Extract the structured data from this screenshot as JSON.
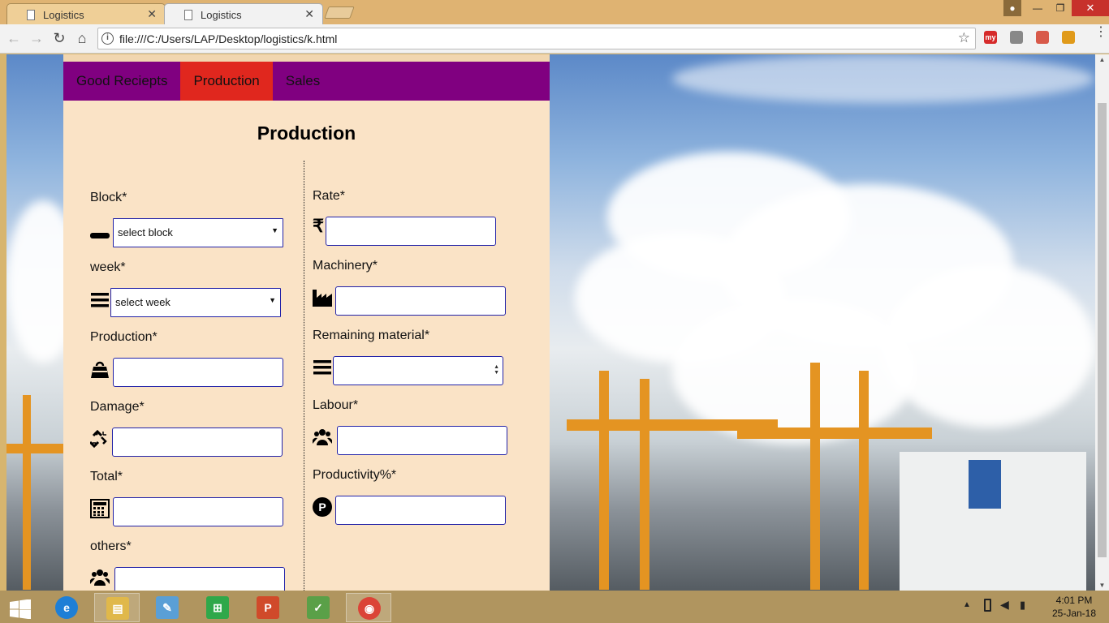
{
  "browser": {
    "tabs": [
      {
        "label": "Logistics",
        "active": false
      },
      {
        "label": "Logistics",
        "active": true
      }
    ],
    "url": "file:///C:/Users/LAP/Desktop/logistics/k.html",
    "extensions": [
      {
        "name": "my-extension",
        "label": "my",
        "color": "#d62b2b"
      },
      {
        "name": "sync-extension",
        "label": "",
        "color": "#888888"
      },
      {
        "name": "dictionary-extension",
        "label": "",
        "color": "#d85a4a"
      },
      {
        "name": "location-extension",
        "label": "",
        "color": "#e09a1a"
      }
    ]
  },
  "nav": {
    "tabs": [
      {
        "label": "Good Reciepts",
        "active": false
      },
      {
        "label": "Production",
        "active": true
      },
      {
        "label": "Sales",
        "active": false
      }
    ]
  },
  "form": {
    "title": "Production",
    "left": {
      "block": {
        "label": "Block*",
        "selected": "select block",
        "icon": "minus-icon"
      },
      "week": {
        "label": "week*",
        "selected": "select week",
        "icon": "bars-icon"
      },
      "production": {
        "label": "Production*",
        "value": "",
        "icon": "weight-icon"
      },
      "damage": {
        "label": "Damage*",
        "value": "",
        "icon": "broken-link-icon"
      },
      "total": {
        "label": "Total*",
        "value": "",
        "icon": "calculator-icon"
      },
      "others": {
        "label": "others*",
        "value": "",
        "icon": "users-icon"
      }
    },
    "right": {
      "rate": {
        "label": "Rate*",
        "value": "",
        "icon": "rupee-icon"
      },
      "machinery": {
        "label": "Machinery*",
        "value": "",
        "icon": "industry-icon"
      },
      "remaining_material": {
        "label": "Remaining material*",
        "value": "",
        "icon": "bars-icon"
      },
      "labour": {
        "label": "Labour*",
        "value": "",
        "icon": "users-icon"
      },
      "productivity": {
        "label": "Productivity%*",
        "value": "",
        "icon": "parking-icon"
      }
    }
  },
  "colors": {
    "panel_bg": "#fae3c6",
    "nav_bg": "#800080",
    "nav_active": "#e0271e",
    "input_border": "#2222a8"
  },
  "taskbar": {
    "apps": [
      {
        "name": "internet-explorer-icon",
        "color": "#1e7fd6"
      },
      {
        "name": "file-explorer-icon",
        "color": "#e0b84a"
      },
      {
        "name": "paint-icon",
        "color": "#5a9fd6"
      },
      {
        "name": "store-icon",
        "color": "#2fa84a"
      },
      {
        "name": "powerpoint-icon",
        "color": "#d04a2a"
      },
      {
        "name": "notepad-icon",
        "color": "#5aa048"
      },
      {
        "name": "chrome-icon",
        "color": "#db4437"
      }
    ],
    "time": "4:01 PM",
    "date": "25-Jan-18"
  }
}
